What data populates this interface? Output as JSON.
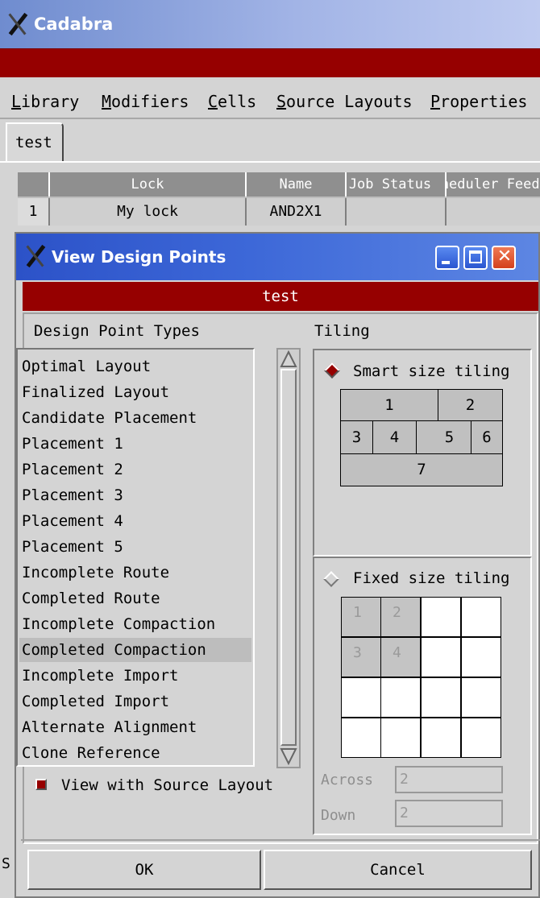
{
  "main_window": {
    "title": "Cadabra",
    "menu": [
      {
        "pre": "",
        "u": "L",
        "post": "ibrary"
      },
      {
        "pre": "",
        "u": "M",
        "post": "odifiers"
      },
      {
        "pre": "",
        "u": "C",
        "post": "ells"
      },
      {
        "pre": "",
        "u": "S",
        "post": "ource Layouts"
      },
      {
        "pre": "",
        "u": "P",
        "post": "roperties"
      }
    ],
    "tab": "test",
    "table": {
      "headers": [
        "Lock",
        "Name",
        "Job Status",
        "Scheduler Feed"
      ],
      "row": {
        "index": "1",
        "lock": "My lock",
        "name": "AND2X1",
        "job_status": "",
        "feed": ""
      }
    },
    "behind_fragment": "S"
  },
  "dialog": {
    "title": "View Design Points",
    "banner": "test",
    "types_label": "Design Point Types",
    "tiling_label": "Tiling",
    "types": [
      "Optimal Layout",
      "Finalized Layout",
      "Candidate Placement",
      "Placement 1",
      "Placement 2",
      "Placement 3",
      "Placement 4",
      "Placement 5",
      "Incomplete Route",
      "Completed Route",
      "Incomplete Compaction",
      "Completed Compaction",
      "Incomplete Import",
      "Completed Import",
      "Alternate Alignment",
      "Clone Reference"
    ],
    "selected_type": "Completed Compaction",
    "view_with_source": "View with Source Layout",
    "view_with_source_checked": true,
    "smart_tiling": {
      "label": "Smart size tiling",
      "selected": true,
      "tiles": [
        "1",
        "2",
        "3",
        "4",
        "5",
        "6",
        "7"
      ]
    },
    "fixed_tiling": {
      "label": "Fixed size tiling",
      "selected": false,
      "tiles": [
        "1",
        "2",
        "3",
        "4"
      ],
      "across_label": "Across",
      "across_value": "2",
      "down_label": "Down",
      "down_value": "2"
    },
    "ok": "OK",
    "cancel": "Cancel"
  },
  "colors": {
    "accent_red": "#960000",
    "dialog_title_blue": "#2c52c8",
    "main_title_blue": "#6f8ccf"
  }
}
